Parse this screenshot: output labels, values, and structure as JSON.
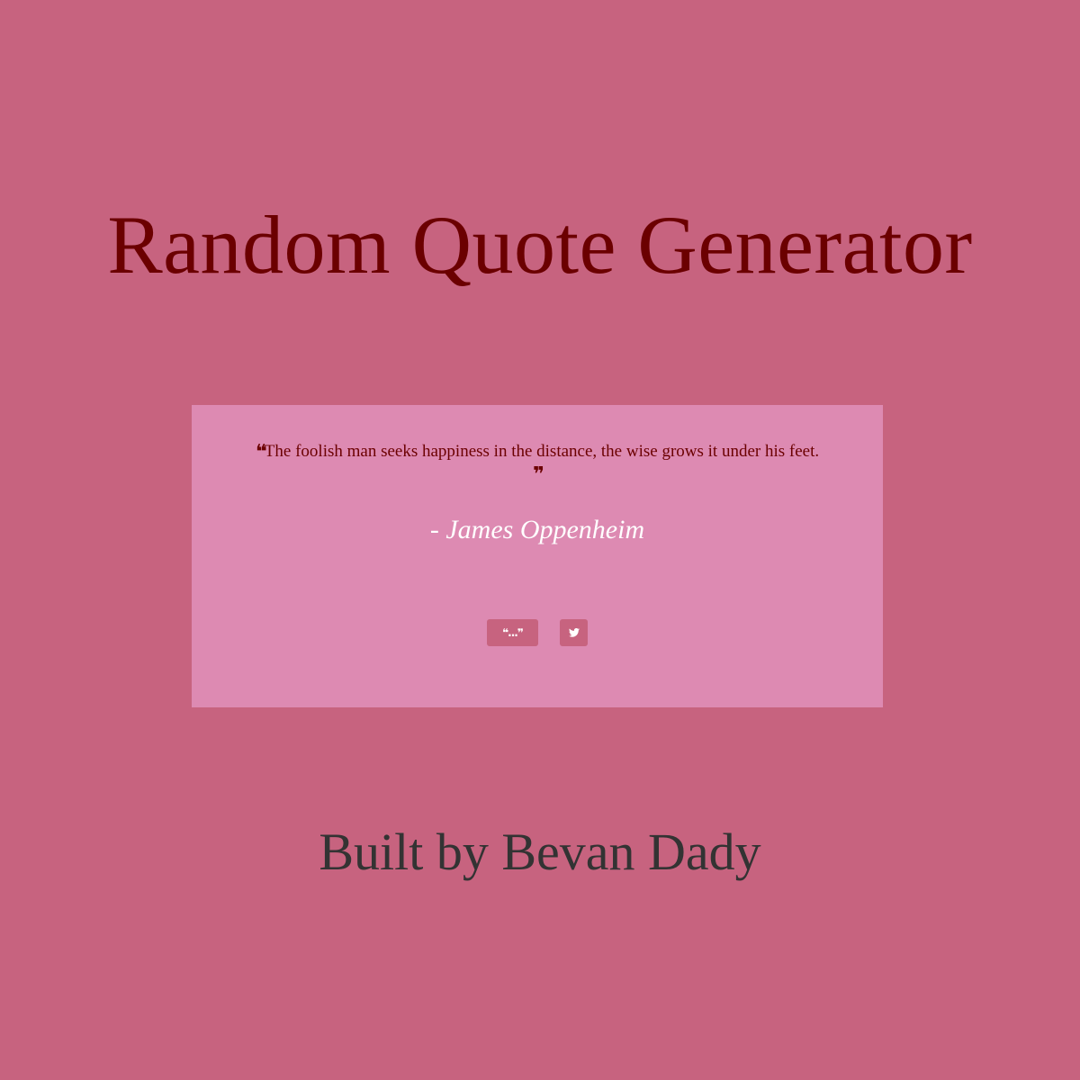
{
  "header": {
    "title": "Random Quote Generator"
  },
  "quote": {
    "open_mark": "❝",
    "text": "The foolish man seeks happiness in the distance, the wise grows it under his feet.",
    "close_mark": "❞",
    "author": "- James Oppenheim"
  },
  "buttons": {
    "new_quote_label": "❝...❞",
    "new_quote_icon": "quote-icon",
    "tweet_label": "🐦",
    "tweet_icon": "twitter-icon"
  },
  "footer": {
    "credit": "Built by Bevan Dady"
  },
  "colors": {
    "background": "#c7637f",
    "card": "#dd8ab2",
    "title": "#6b0000",
    "author": "#ffffff",
    "footer": "#333333"
  }
}
